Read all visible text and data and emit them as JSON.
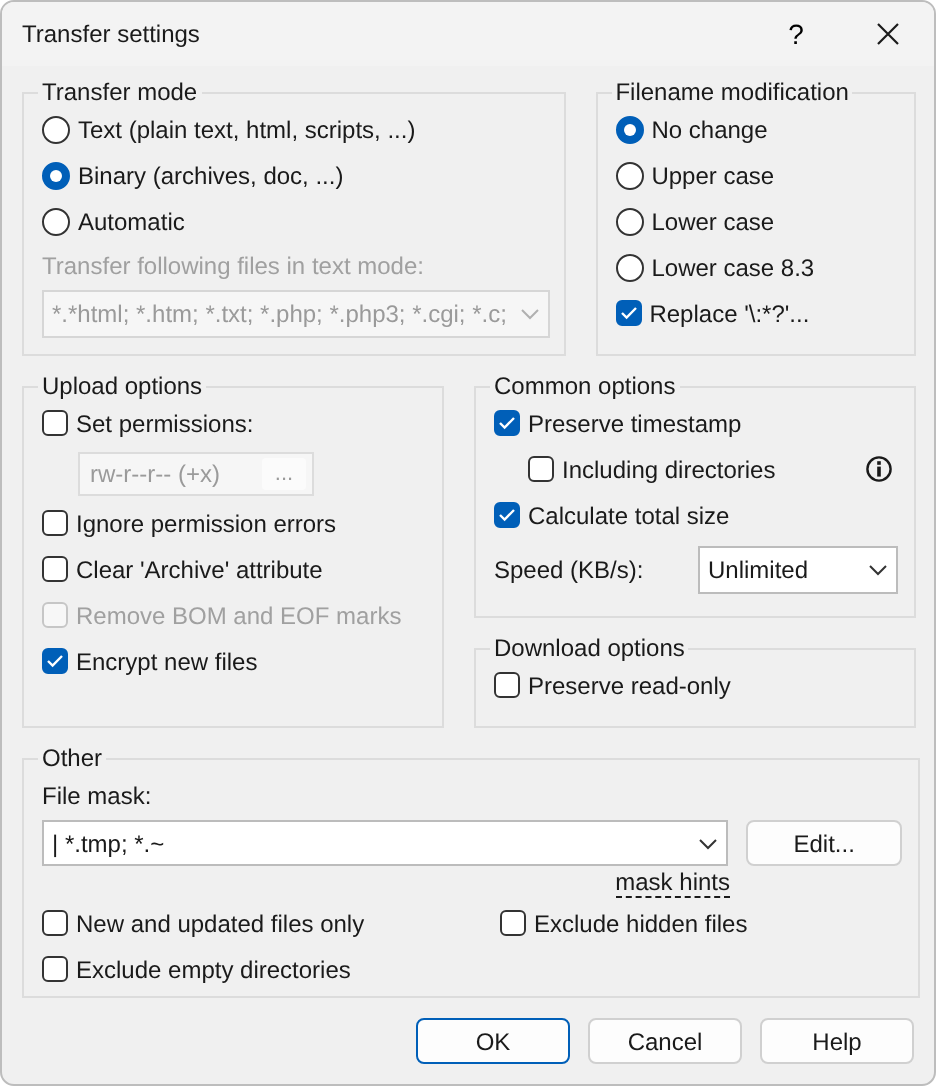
{
  "window": {
    "title": "Transfer settings",
    "help_button": "?"
  },
  "transfer_mode": {
    "title": "Transfer mode",
    "options": [
      {
        "label": "Text (plain text, html, scripts, ...)",
        "selected": false
      },
      {
        "label": "Binary (archives, doc, ...)",
        "selected": true
      },
      {
        "label": "Automatic",
        "selected": false
      }
    ],
    "text_mode_label": "Transfer following files in text mode:",
    "text_mode_mask": {
      "value": "*.*html; *.htm; *.txt; *.php; *.php3; *.cgi; *.c;",
      "disabled": true
    }
  },
  "filename_modification": {
    "title": "Filename modification",
    "options": [
      {
        "kind": "radio",
        "label": "No change",
        "selected": true
      },
      {
        "kind": "radio",
        "label": "Upper case",
        "selected": false
      },
      {
        "kind": "radio",
        "label": "Lower case",
        "selected": false
      },
      {
        "kind": "radio",
        "label": "Lower case 8.3",
        "selected": false
      },
      {
        "kind": "checkbox",
        "label": "Replace '\\:*?'...",
        "checked": true
      }
    ]
  },
  "upload_options": {
    "title": "Upload options",
    "items": [
      {
        "kind": "checkbox",
        "label": "Set permissions:",
        "checked": false,
        "disabled": false
      },
      {
        "kind": "permissions",
        "value": "rw-r--r-- (+x)",
        "button": "...",
        "disabled": true
      },
      {
        "kind": "checkbox",
        "label": "Ignore permission errors",
        "checked": false,
        "disabled": false
      },
      {
        "kind": "checkbox",
        "label": "Clear 'Archive' attribute",
        "checked": false,
        "disabled": false
      },
      {
        "kind": "checkbox",
        "label": "Remove BOM and EOF marks",
        "checked": false,
        "disabled": true
      },
      {
        "kind": "checkbox",
        "label": "Encrypt new files",
        "checked": true,
        "disabled": false
      }
    ]
  },
  "common_options": {
    "title": "Common options",
    "items": [
      {
        "label": "Preserve timestamp",
        "checked": true,
        "children": [
          {
            "label": "Including directories",
            "checked": false
          }
        ]
      },
      {
        "label": "Calculate total size",
        "checked": true
      }
    ],
    "speed": {
      "label": "Speed (KB/s):",
      "value": "Unlimited"
    }
  },
  "download_options": {
    "title": "Download options",
    "items": [
      {
        "label": "Preserve read-only",
        "checked": false
      }
    ]
  },
  "other": {
    "title": "Other",
    "file_mask_label": "File mask:",
    "file_mask_value": "| *.tmp; *.~",
    "edit_button": "Edit...",
    "mask_hints": "mask hints",
    "items": [
      {
        "label": "New and updated files only",
        "checked": false
      },
      {
        "label": "Exclude hidden files",
        "checked": false
      },
      {
        "label": "Exclude empty directories",
        "checked": false
      }
    ]
  },
  "buttons": [
    {
      "label": "OK",
      "default": true
    },
    {
      "label": "Cancel",
      "default": false
    },
    {
      "label": "Help",
      "default": false
    }
  ]
}
